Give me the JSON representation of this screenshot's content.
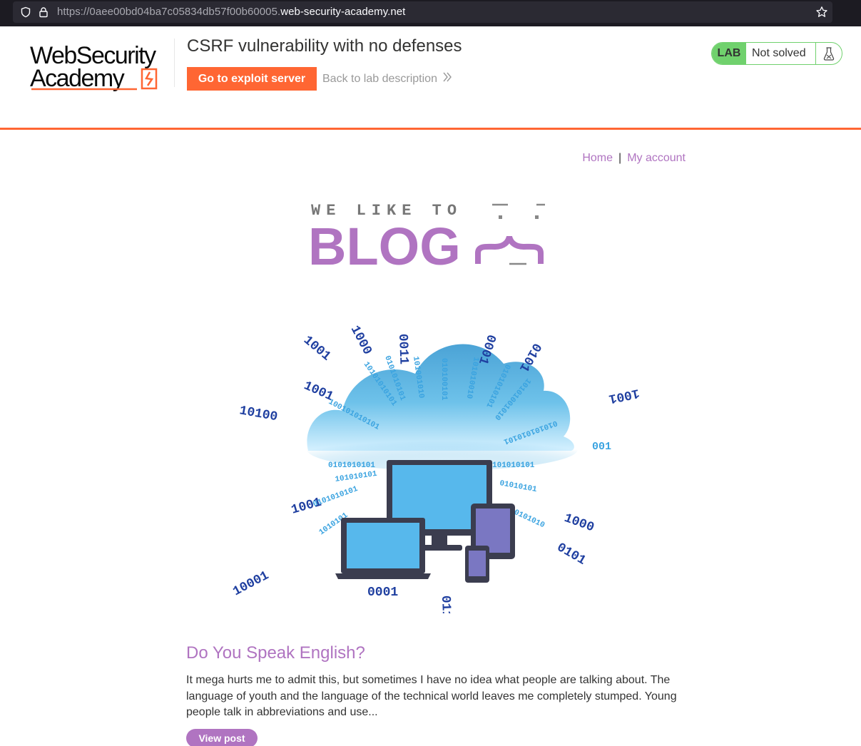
{
  "browser": {
    "url_prefix": "https://0aee00bd04ba7c05834db57f00b60005.",
    "url_domain": "web-security-academy.net"
  },
  "header": {
    "logo_line1": "WebSecurity",
    "logo_line2": "Academy",
    "lab_title": "CSRF vulnerability with no defenses",
    "exploit_button": "Go to exploit server",
    "back_link": "Back to lab description",
    "status_badge": "LAB",
    "status_text": "Not solved",
    "accent_color": "#ff6633",
    "status_color": "#70d16d"
  },
  "nav": {
    "home": "Home",
    "separator": "|",
    "my_account": "My account"
  },
  "banner": {
    "tagline": "WE LIKE TO",
    "word": "BLOG",
    "accent_color": "#b074c1"
  },
  "hero": {
    "icon": "cloud-devices-binary-image"
  },
  "post": {
    "title": "Do You Speak English?",
    "summary": "It mega hurts me to admit this, but sometimes I have no idea what people are talking about. The language of youth and the language of the technical world leaves me completely stumped. Young people talk in abbreviations and use...",
    "button": "View post"
  }
}
